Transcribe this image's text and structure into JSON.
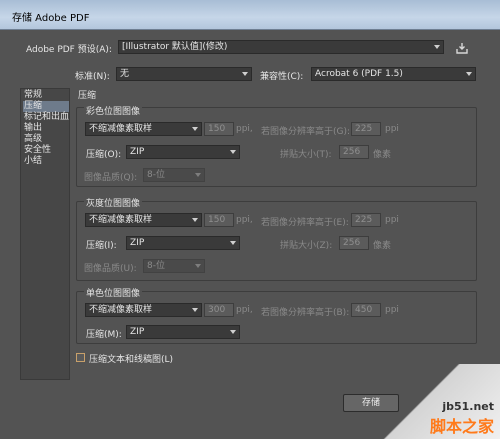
{
  "window": {
    "title": "存储 Adobe PDF"
  },
  "preset": {
    "label": "Adobe PDF 预设(A):",
    "value": "[Illustrator 默认值](修改)"
  },
  "standard": {
    "label": "标准(N):",
    "value": "无"
  },
  "compat": {
    "label": "兼容性(C):",
    "value": "Acrobat 6 (PDF 1.5)"
  },
  "sidebar": {
    "items": [
      {
        "label": "常规"
      },
      {
        "label": "压缩"
      },
      {
        "label": "标记和出血"
      },
      {
        "label": "输出"
      },
      {
        "label": "高级"
      },
      {
        "label": "安全性"
      },
      {
        "label": "小结"
      }
    ],
    "selected": 1
  },
  "section": {
    "title": "压缩"
  },
  "color": {
    "title": "彩色位图图像",
    "sampling": "不缩减像素取样",
    "ppi_value": "150",
    "ppi_unit": "ppi,",
    "above_label": "若图像分辨率高于(G):",
    "above_value": "225",
    "above_unit": "ppi",
    "compress_label": "压缩(O):",
    "compress_value": "ZIP",
    "tile_label": "拼贴大小(T):",
    "tile_value": "256",
    "tile_unit": "像素",
    "quality_label": "图像品质(Q):",
    "quality_value": "8-位"
  },
  "gray": {
    "title": "灰度位图图像",
    "sampling": "不缩减像素取样",
    "ppi_value": "150",
    "ppi_unit": "ppi,",
    "above_label": "若图像分辨率高于(E):",
    "above_value": "225",
    "above_unit": "ppi",
    "compress_label": "压缩(I):",
    "compress_value": "ZIP",
    "tile_label": "拼贴大小(Z):",
    "tile_value": "256",
    "tile_unit": "像素",
    "quality_label": "图像品质(U):",
    "quality_value": "8-位"
  },
  "mono": {
    "title": "单色位图图像",
    "sampling": "不缩减像素取样",
    "ppi_value": "300",
    "ppi_unit": "ppi,",
    "above_label": "若图像分辨率高于(B):",
    "above_value": "450",
    "above_unit": "ppi",
    "compress_label": "压缩(M):",
    "compress_value": "ZIP"
  },
  "compress_text": {
    "label": "压缩文本和线稿图(L)"
  },
  "buttons": {
    "save": "存储"
  },
  "watermark": {
    "site": "jb51.net",
    "name": "脚本之家"
  }
}
